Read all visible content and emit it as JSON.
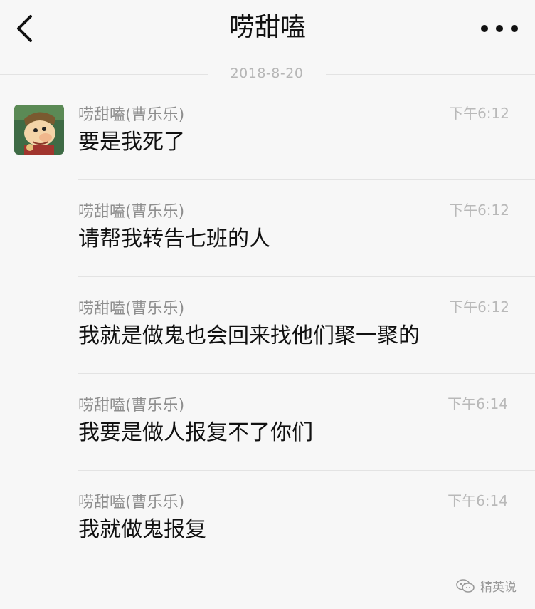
{
  "header": {
    "title": "唠甜嗑",
    "back_icon": "chevron-left-icon",
    "more_icon": "more-dots-icon"
  },
  "date_separator": "2018-8-20",
  "messages": [
    {
      "sender": "唠甜嗑(曹乐乐)",
      "time": "下午6:12",
      "text": "要是我死了"
    },
    {
      "sender": "唠甜嗑(曹乐乐)",
      "time": "下午6:12",
      "text": "请帮我转告七班的人"
    },
    {
      "sender": "唠甜嗑(曹乐乐)",
      "time": "下午6:12",
      "text": "我就是做鬼也会回来找他们聚一聚的"
    },
    {
      "sender": "唠甜嗑(曹乐乐)",
      "time": "下午6:14",
      "text": "我要是做人报复不了你们"
    },
    {
      "sender": "唠甜嗑(曹乐乐)",
      "time": "下午6:14",
      "text": "我就做鬼报复"
    }
  ],
  "watermark": {
    "label": "精英说",
    "icon": "wechat-icon"
  }
}
